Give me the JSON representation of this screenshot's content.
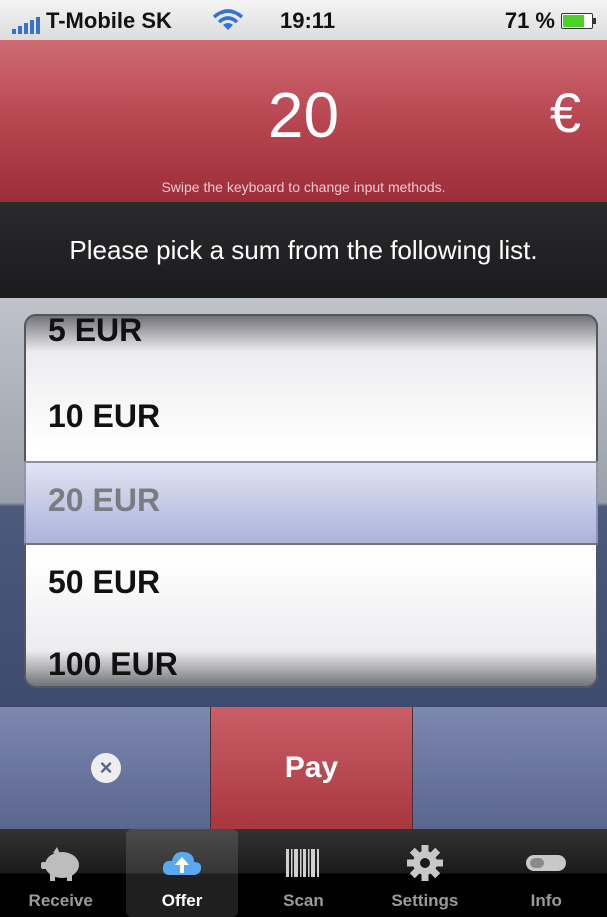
{
  "status": {
    "carrier": "T-Mobile SK",
    "time": "19:11",
    "battery": "71 %"
  },
  "amount": {
    "value": "20",
    "currency": "€",
    "hint": "Swipe the keyboard to change input methods."
  },
  "instruction": "Please pick a sum from the following list.",
  "picker": {
    "options": [
      "5 EUR",
      "10 EUR",
      "20 EUR",
      "50 EUR",
      "100 EUR"
    ],
    "selected": "20 EUR"
  },
  "actions": {
    "cancel_icon": "×",
    "pay_label": "Pay"
  },
  "tabs": [
    {
      "label": "Receive",
      "icon": "piggy-bank-icon"
    },
    {
      "label": "Offer",
      "icon": "cloud-upload-icon"
    },
    {
      "label": "Scan",
      "icon": "barcode-icon"
    },
    {
      "label": "Settings",
      "icon": "gear-icon"
    },
    {
      "label": "Info",
      "icon": "toggle-icon"
    }
  ],
  "colors": {
    "header_red": "#b84651",
    "pay_red": "#c95f68",
    "picker_blue": "#5b6690"
  }
}
